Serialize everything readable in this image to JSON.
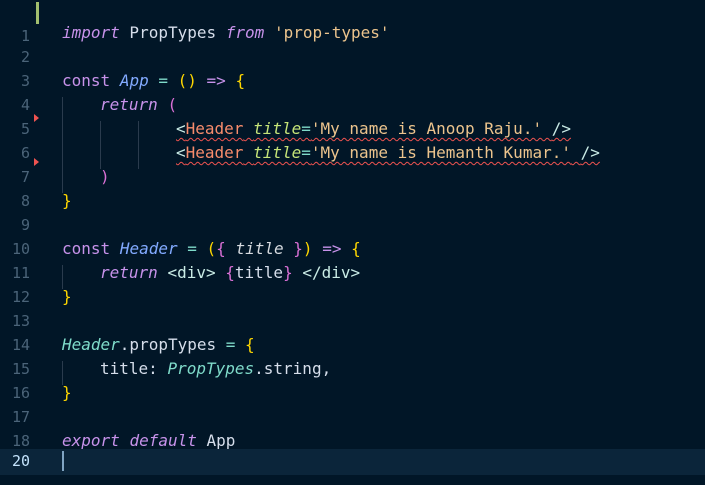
{
  "editor": {
    "current_line": "20",
    "lines": [
      {
        "no": "1"
      },
      {
        "no": "2",
        "t": [
          "import",
          " PropTypes ",
          "from",
          " ",
          "'prop-types'"
        ]
      },
      {
        "no": "3"
      },
      {
        "no": "4",
        "t": [
          "const",
          " ",
          "App",
          " ",
          "=",
          " ",
          "()",
          " ",
          "=>",
          " ",
          "{"
        ]
      },
      {
        "no": "5",
        "t": [
          "return",
          " ",
          "("
        ]
      },
      {
        "no": "6",
        "t": [
          "<",
          "Header",
          " ",
          "title",
          "=",
          "'My name is Anoop Raju.'",
          " ",
          "/>"
        ]
      },
      {
        "no": "7",
        "t": [
          "<",
          "Header",
          " ",
          "title",
          "=",
          "'My name is Hemanth Kumar.'",
          " ",
          "/>"
        ]
      },
      {
        "no": "8",
        "t": [
          ")"
        ]
      },
      {
        "no": "9",
        "t": [
          "}"
        ]
      },
      {
        "no": "10"
      },
      {
        "no": "11",
        "t": [
          "const",
          " ",
          "Header",
          " ",
          "=",
          " ",
          "(",
          "{",
          " ",
          "title",
          " ",
          "}",
          ")",
          " ",
          "=>",
          " ",
          "{"
        ]
      },
      {
        "no": "12",
        "t": [
          "return",
          " ",
          "<div>",
          " ",
          "{",
          "title",
          "}",
          " ",
          "</div>"
        ]
      },
      {
        "no": "13",
        "t": [
          "}"
        ]
      },
      {
        "no": "14"
      },
      {
        "no": "15",
        "t": [
          "Header",
          ".propTypes",
          " ",
          "=",
          " ",
          "{"
        ]
      },
      {
        "no": "16",
        "t": [
          "title: ",
          "PropTypes",
          ".string,"
        ]
      },
      {
        "no": "17",
        "t": [
          "}"
        ]
      },
      {
        "no": "18"
      },
      {
        "no": "19",
        "t": [
          "export",
          " ",
          "default",
          " ",
          "App"
        ]
      },
      {
        "no": "20"
      }
    ]
  }
}
